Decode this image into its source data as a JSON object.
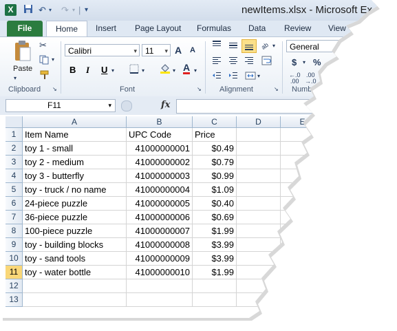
{
  "window": {
    "app_icon": "excel-icon",
    "title": "newItems.xlsx  -  Microsoft Ex"
  },
  "ribbon_tabs": [
    "File",
    "Home",
    "Insert",
    "Page Layout",
    "Formulas",
    "Data",
    "Review",
    "View"
  ],
  "ribbon": {
    "clipboard": {
      "paste_label": "Paste",
      "group_label": "Clipboard"
    },
    "font": {
      "font_name": "Calibri",
      "font_size": "11",
      "bold": "B",
      "italic": "I",
      "underline": "U",
      "font_color_label": "A",
      "grow_label": "A",
      "shrink_label": "A",
      "group_label": "Font"
    },
    "alignment": {
      "group_label": "Alignment"
    },
    "number": {
      "format": "General",
      "currency": "$",
      "percent": "%",
      "group_label": "Numb"
    }
  },
  "formula_bar": {
    "name_box": "F11",
    "fx_label": "fx",
    "formula": ""
  },
  "grid": {
    "columns": [
      "A",
      "B",
      "C",
      "D",
      "E"
    ],
    "row_numbers": [
      "1",
      "2",
      "3",
      "4",
      "5",
      "6",
      "7",
      "8",
      "9",
      "10",
      "11",
      "12",
      "13"
    ],
    "active_row": "11",
    "header": [
      "Item Name",
      "UPC Code",
      "Price"
    ],
    "rows": [
      [
        "toy 1 - small",
        "41000000001",
        "$0.49"
      ],
      [
        "toy 2 - medium",
        "41000000002",
        "$0.79"
      ],
      [
        "toy 3 - butterfly",
        "41000000003",
        "$0.99"
      ],
      [
        "toy - truck / no name",
        "41000000004",
        "$1.09"
      ],
      [
        "24-piece puzzle",
        "41000000005",
        "$0.40"
      ],
      [
        "36-piece puzzle",
        "41000000006",
        "$0.69"
      ],
      [
        "100-piece puzzle",
        "41000000007",
        "$1.99"
      ],
      [
        "toy - building blocks",
        "41000000008",
        "$3.99"
      ],
      [
        "toy - sand tools",
        "41000000009",
        "$3.99"
      ],
      [
        "toy - water bottle",
        "41000000010",
        "$1.99"
      ]
    ]
  },
  "colors": {
    "file_tab": "#2b7c3f",
    "active_row_header": "#f9d778",
    "app_icon": "#1e7145"
  }
}
